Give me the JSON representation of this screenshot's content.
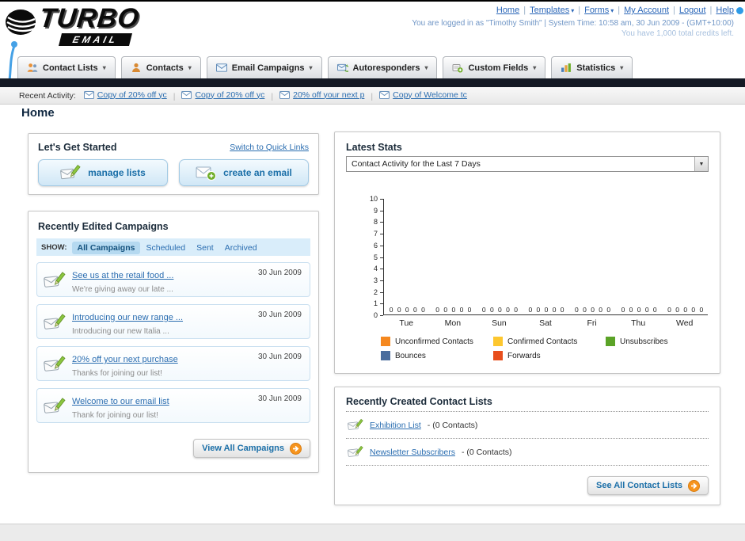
{
  "header": {
    "logo": {
      "primary": "TURBO",
      "secondary": "EMAIL"
    },
    "nav_links": [
      {
        "label": "Home",
        "dropdown": false
      },
      {
        "label": "Templates",
        "dropdown": true
      },
      {
        "label": "Forms",
        "dropdown": true
      },
      {
        "label": "My Account",
        "dropdown": false
      },
      {
        "label": "Logout",
        "dropdown": false
      },
      {
        "label": "Help",
        "dropdown": false
      }
    ],
    "login_info": "You are logged in as \"Timothy Smith\" | System Time: 10:58 am, 30 Jun 2009 - (GMT+10:00)",
    "credits_info": "You have 1,000 total credits left."
  },
  "nav_tabs": [
    {
      "label": "Contact Lists",
      "icon": "contact-lists-icon"
    },
    {
      "label": "Contacts",
      "icon": "contacts-icon"
    },
    {
      "label": "Email Campaigns",
      "icon": "email-campaigns-icon"
    },
    {
      "label": "Autoresponders",
      "icon": "autoresponders-icon"
    },
    {
      "label": "Custom Fields",
      "icon": "custom-fields-icon"
    },
    {
      "label": "Statistics",
      "icon": "statistics-icon"
    }
  ],
  "recent_activity": {
    "label": "Recent Activity:",
    "items": [
      "Copy of 20% off yc",
      "Copy of 20% off yc",
      "20% off your next p",
      "Copy of Welcome tc"
    ]
  },
  "page_title": "Home",
  "get_started": {
    "title": "Let's Get Started",
    "switch_link": "Switch to Quick Links",
    "buttons": [
      {
        "label": "manage lists",
        "icon": "envelope-pencil-icon"
      },
      {
        "label": "create an email",
        "icon": "envelope-plus-icon"
      }
    ]
  },
  "campaigns": {
    "title": "Recently Edited Campaigns",
    "show_label": "SHOW:",
    "show_tabs": [
      "All Campaigns",
      "Scheduled",
      "Sent",
      "Archived"
    ],
    "active_tab": "All Campaigns",
    "items": [
      {
        "title": "See us at the retail food ...",
        "subtitle": "We're giving away our late ...",
        "date": "30 Jun 2009"
      },
      {
        "title": "Introducing our new range ...",
        "subtitle": "Introducing our new Italia ...",
        "date": "30 Jun 2009"
      },
      {
        "title": "20% off your next purchase",
        "subtitle": "Thanks for joining our list!",
        "date": "30 Jun 2009"
      },
      {
        "title": "Welcome to our email list",
        "subtitle": "Thank for joining our list!",
        "date": "30 Jun 2009"
      }
    ],
    "view_all_label": "View All Campaigns"
  },
  "stats": {
    "title": "Latest Stats",
    "period_selected": "Contact Activity for the Last 7 Days"
  },
  "chart_data": {
    "type": "bar",
    "title": "Contact Activity for the Last 7 Days",
    "categories": [
      "Tue",
      "Mon",
      "Sun",
      "Sat",
      "Fri",
      "Thu",
      "Wed"
    ],
    "series": [
      {
        "name": "Unconfirmed Contacts",
        "color": "#f5881f",
        "values": [
          0,
          0,
          0,
          0,
          0,
          0,
          0
        ]
      },
      {
        "name": "Confirmed Contacts",
        "color": "#fdc72f",
        "values": [
          0,
          0,
          0,
          0,
          0,
          0,
          0
        ]
      },
      {
        "name": "Unsubscribes",
        "color": "#5ba327",
        "values": [
          0,
          0,
          0,
          0,
          0,
          0,
          0
        ]
      },
      {
        "name": "Bounces",
        "color": "#4a6d9d",
        "values": [
          0,
          0,
          0,
          0,
          0,
          0,
          0
        ]
      },
      {
        "name": "Forwards",
        "color": "#e84e1c",
        "values": [
          0,
          0,
          0,
          0,
          0,
          0,
          0
        ]
      }
    ],
    "ylim": [
      0,
      10
    ],
    "yticks": [
      0,
      1,
      2,
      3,
      4,
      5,
      6,
      7,
      8,
      9,
      10
    ],
    "show_value_labels": true,
    "grid": false,
    "legend_position": "bottom"
  },
  "contact_lists": {
    "title": "Recently Created Contact Lists",
    "items": [
      {
        "name": "Exhibition List",
        "suffix": "- (0 Contacts)"
      },
      {
        "name": "Newsletter Subscribers",
        "suffix": "- (0 Contacts)"
      }
    ],
    "see_all_label": "See All Contact Lists"
  },
  "colors": {
    "link": "#2a6db0",
    "nav_dark_bar": "#151a25",
    "button_text": "#1b6fa8",
    "arrow_button_accent": "#f7941d"
  }
}
